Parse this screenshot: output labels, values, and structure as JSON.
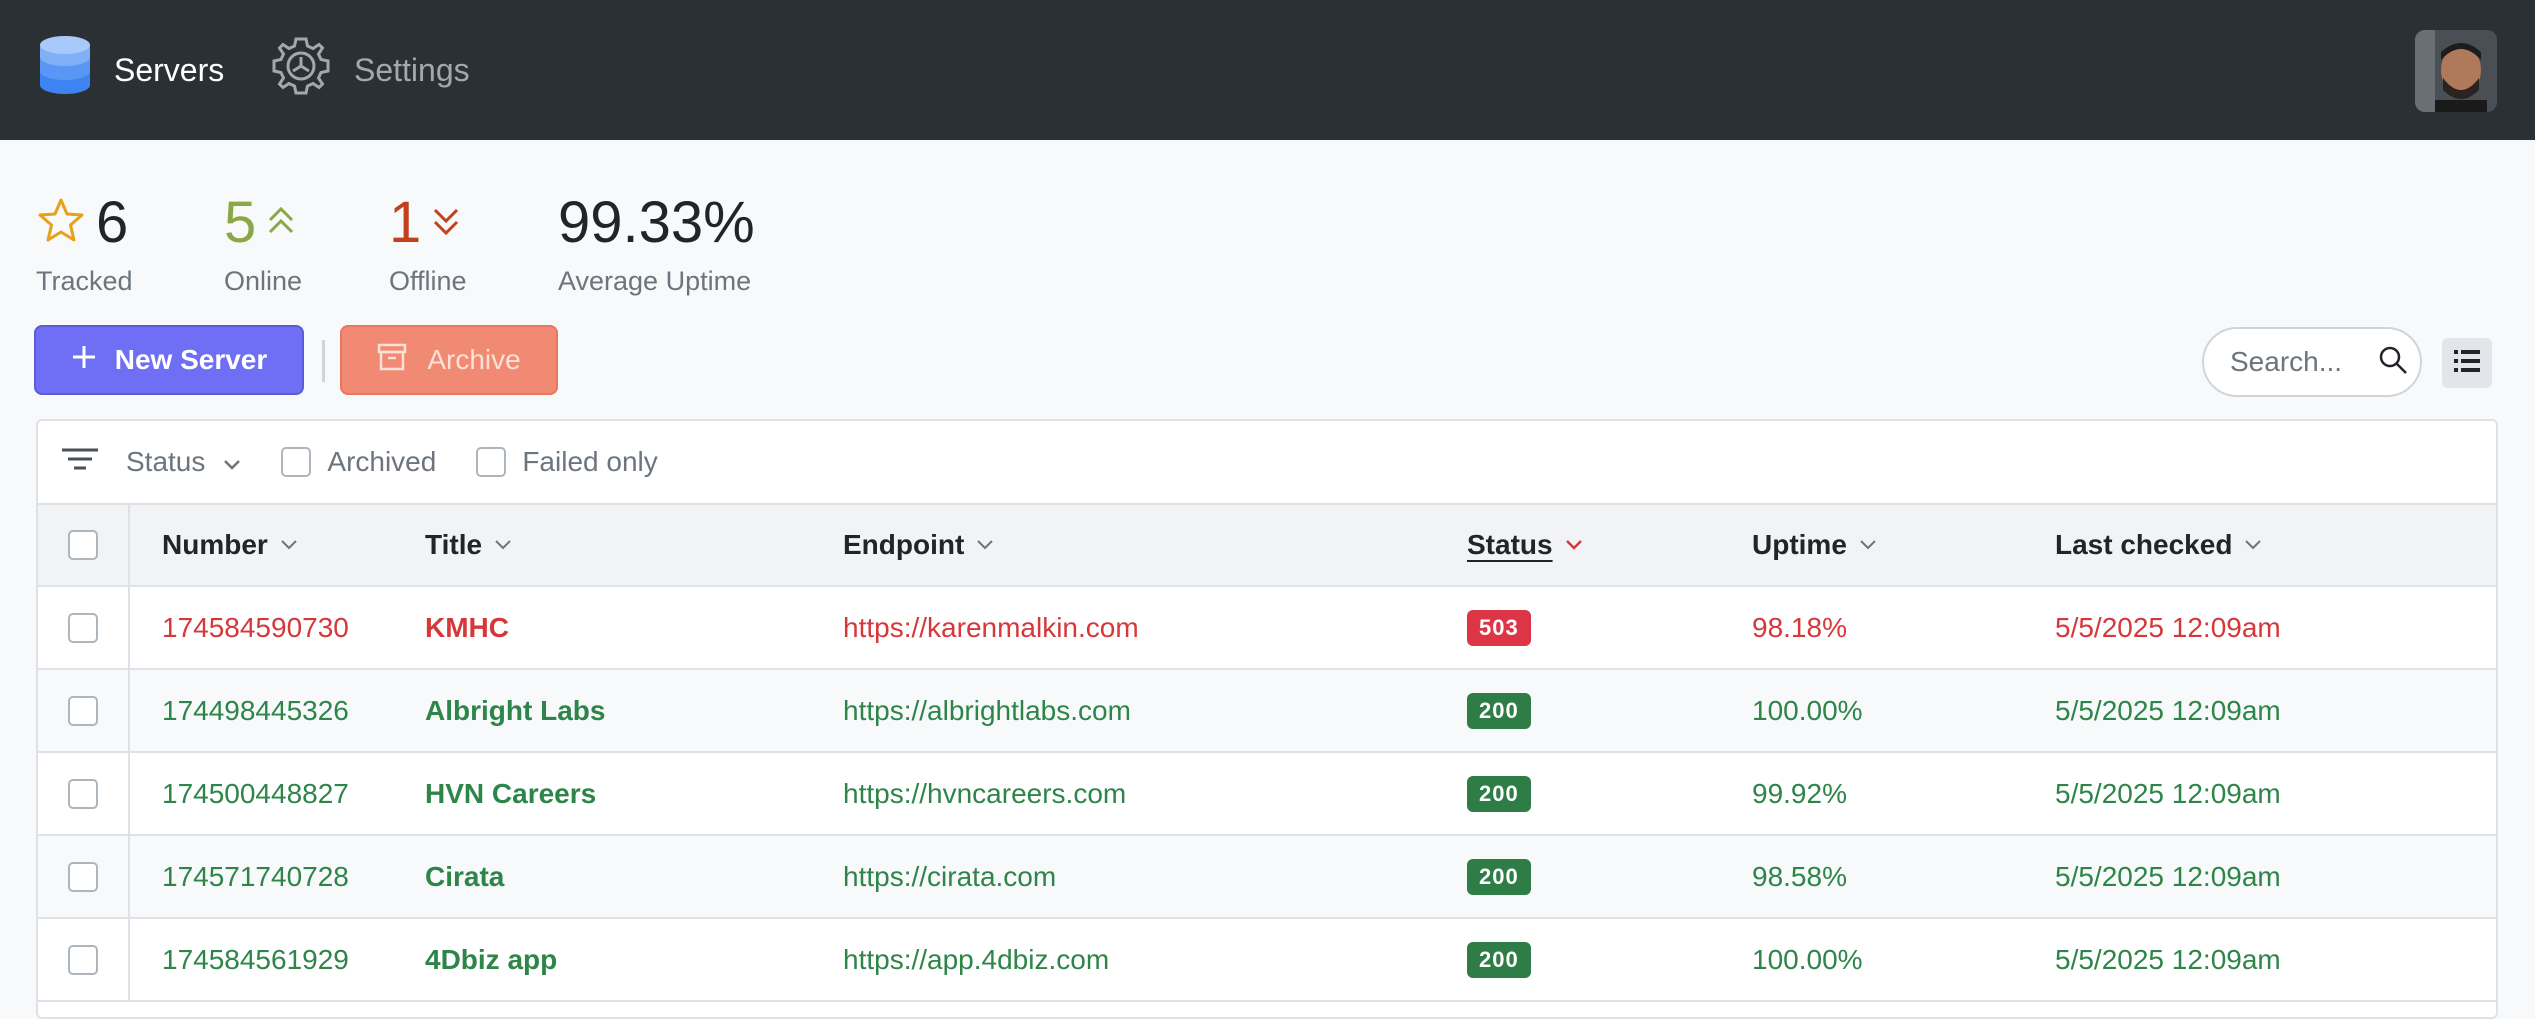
{
  "nav": {
    "servers_label": "Servers",
    "settings_label": "Settings"
  },
  "stats": {
    "tracked": {
      "value": "6",
      "label": "Tracked"
    },
    "online": {
      "value": "5",
      "label": "Online"
    },
    "offline": {
      "value": "1",
      "label": "Offline"
    },
    "uptime": {
      "value": "99.33%",
      "label": "Average Uptime"
    }
  },
  "actions": {
    "new_server_label": "New Server",
    "archive_label": "Archive",
    "search_placeholder": "Search..."
  },
  "filters": {
    "status_label": "Status",
    "archived_label": "Archived",
    "failed_only_label": "Failed only"
  },
  "table": {
    "columns": {
      "number": "Number",
      "title": "Title",
      "endpoint": "Endpoint",
      "status": "Status",
      "uptime": "Uptime",
      "last_checked": "Last checked"
    },
    "rows": [
      {
        "number": "174584590730",
        "title": "KMHC",
        "endpoint": "https://karenmalkin.com",
        "status": "503",
        "uptime": "98.18%",
        "last_checked": "5/5/2025 12:09am",
        "state": "failed"
      },
      {
        "number": "174498445326",
        "title": "Albright Labs",
        "endpoint": "https://albrightlabs.com",
        "status": "200",
        "uptime": "100.00%",
        "last_checked": "5/5/2025 12:09am",
        "state": "ok"
      },
      {
        "number": "174500448827",
        "title": "HVN Careers",
        "endpoint": "https://hvncareers.com",
        "status": "200",
        "uptime": "99.92%",
        "last_checked": "5/5/2025 12:09am",
        "state": "ok"
      },
      {
        "number": "174571740728",
        "title": "Cirata",
        "endpoint": "https://cirata.com",
        "status": "200",
        "uptime": "98.58%",
        "last_checked": "5/5/2025 12:09am",
        "state": "ok"
      },
      {
        "number": "174584561929",
        "title": "4Dbiz app",
        "endpoint": "https://app.4dbiz.com",
        "status": "200",
        "uptime": "100.00%",
        "last_checked": "5/5/2025 12:09am",
        "state": "ok"
      }
    ]
  },
  "colors": {
    "navbar": "#2b3035",
    "primary": "#6e6ff4",
    "archive": "#f08a72",
    "online": "#8aa846",
    "offline": "#c0411b",
    "failed": "#d6383a",
    "ok": "#2e8549"
  },
  "icons": {
    "brand": "database-icon",
    "settings": "gear-icon",
    "tracked": "star-icon",
    "online": "chevron-double-up-icon",
    "offline": "chevron-double-down-icon",
    "search": "search-icon",
    "view": "list-view-icon",
    "filter": "filter-icon"
  }
}
